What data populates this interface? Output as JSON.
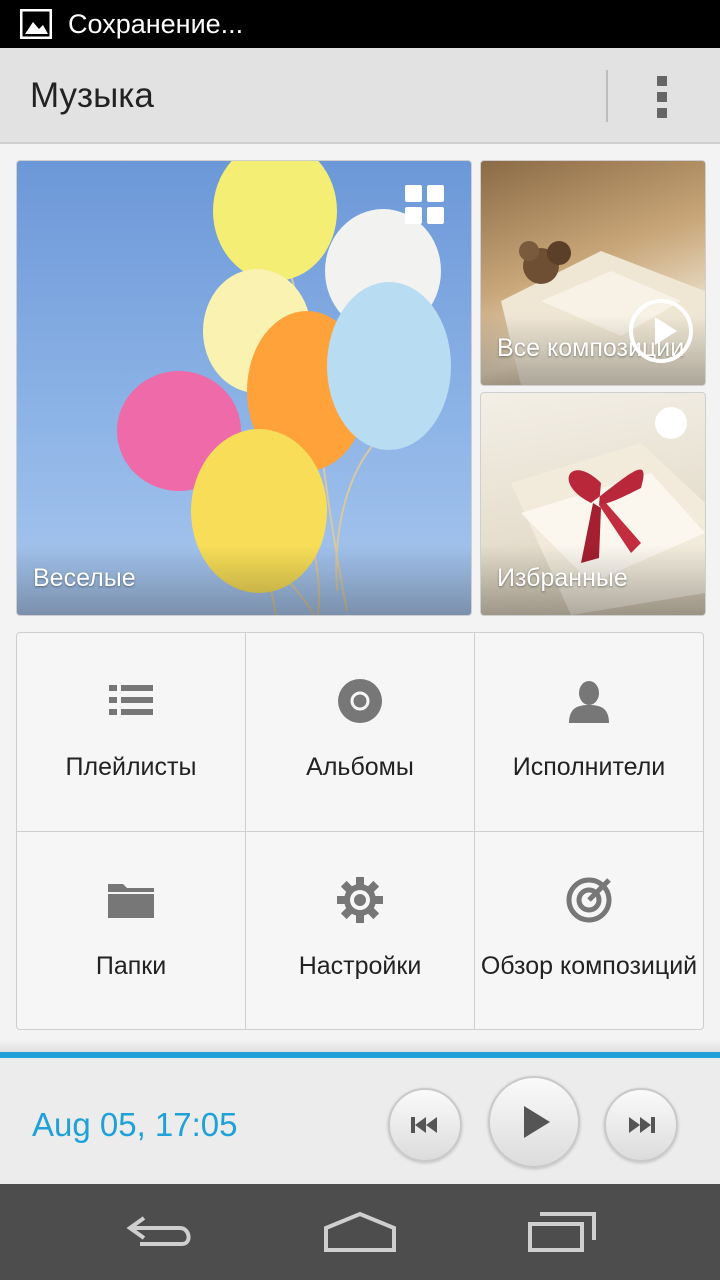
{
  "status_bar": {
    "text": "Сохранение...",
    "icon": "image-icon"
  },
  "action_bar": {
    "title": "Музыка",
    "overflow_icon": "overflow-menu-icon"
  },
  "tiles": [
    {
      "label": "Веселые",
      "icon": "grid-view-icon"
    },
    {
      "label": "Все композиции",
      "icon": "play-circle-icon"
    },
    {
      "label": "Избранные"
    }
  ],
  "menu": [
    {
      "label": "Плейлисты",
      "icon": "list-icon"
    },
    {
      "label": "Альбомы",
      "icon": "disc-icon"
    },
    {
      "label": "Исполнители",
      "icon": "person-icon"
    },
    {
      "label": "Папки",
      "icon": "folder-icon"
    },
    {
      "label": "Настройки",
      "icon": "gear-icon"
    },
    {
      "label": "Обзор композиций",
      "icon": "target-icon"
    }
  ],
  "now_playing": {
    "time": "Aug 05, 17:05",
    "accent_color": "#1ea0d8"
  },
  "nav": {
    "back": "back-icon",
    "home": "home-icon",
    "recents": "recents-icon"
  }
}
